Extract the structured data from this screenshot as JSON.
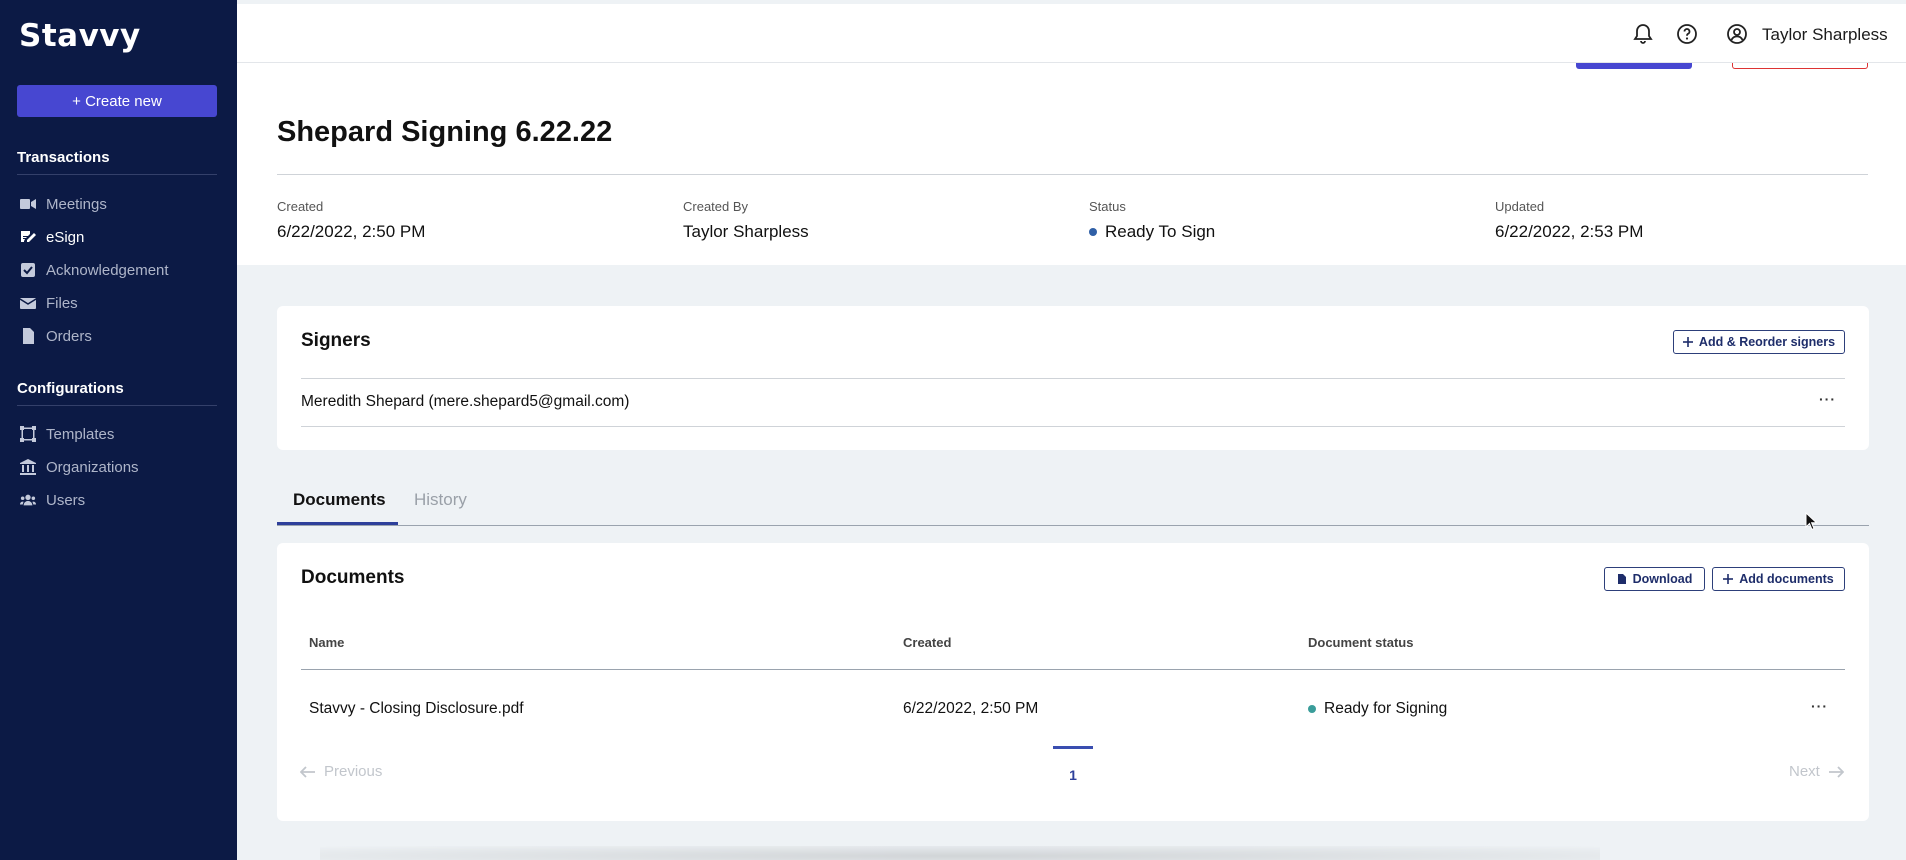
{
  "app": {
    "logo": "Stavvy"
  },
  "sidebar": {
    "create_label": "+ Create new",
    "section1": "Transactions",
    "items1": [
      {
        "label": "Meetings",
        "icon": "video-icon"
      },
      {
        "label": "eSign",
        "icon": "sign-icon"
      },
      {
        "label": "Acknowledgement",
        "icon": "checkbox-icon"
      },
      {
        "label": "Files",
        "icon": "envelope-icon"
      },
      {
        "label": "Orders",
        "icon": "document-icon"
      }
    ],
    "section2": "Configurations",
    "items2": [
      {
        "label": "Templates",
        "icon": "template-icon"
      },
      {
        "label": "Organizations",
        "icon": "bank-icon"
      },
      {
        "label": "Users",
        "icon": "users-icon"
      }
    ]
  },
  "header": {
    "user_name": "Taylor Sharpless"
  },
  "page": {
    "title": "Shepard Signing 6.22.22",
    "meta": {
      "created_label": "Created",
      "created_value": "6/22/2022, 2:50 PM",
      "created_by_label": "Created By",
      "created_by_value": "Taylor Sharpless",
      "status_label": "Status",
      "status_value": "Ready To Sign",
      "updated_label": "Updated",
      "updated_value": "6/22/2022, 2:53 PM"
    }
  },
  "signers": {
    "title": "Signers",
    "add_button": "Add & Reorder signers",
    "rows": [
      {
        "name": "Meredith Shepard (mere.shepard5@gmail.com)"
      }
    ]
  },
  "tabs": [
    {
      "label": "Documents"
    },
    {
      "label": "History"
    }
  ],
  "documents": {
    "title": "Documents",
    "download_button": "Download",
    "add_button": "Add documents",
    "columns": [
      "Name",
      "Created",
      "Document status"
    ],
    "rows": [
      {
        "name": "Stavvy - Closing Disclosure.pdf",
        "created": "6/22/2022, 2:50 PM",
        "status": "Ready for Signing"
      }
    ],
    "pagination": {
      "previous": "Previous",
      "current_page": "1",
      "next": "Next"
    }
  },
  "colors": {
    "sidebar_bg": "#0c1a45",
    "accent": "#4747d1",
    "status_dot": "#2f5fa6",
    "ready_dot": "#3a9d9a"
  }
}
